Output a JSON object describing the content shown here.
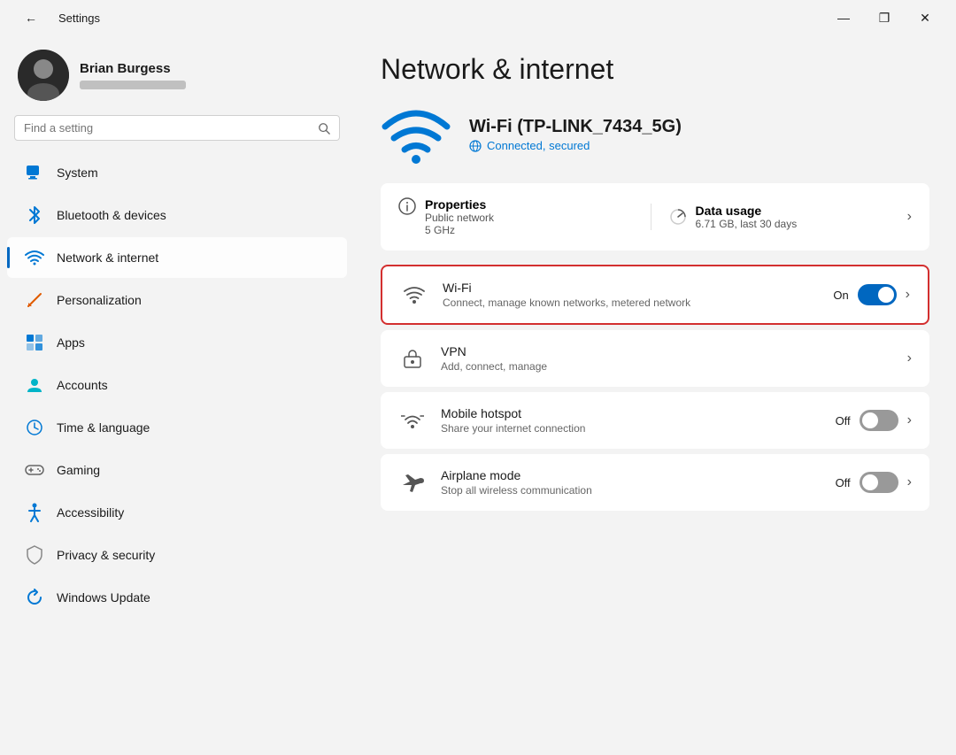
{
  "titlebar": {
    "title": "Settings",
    "back_label": "←",
    "minimize_label": "—",
    "maximize_label": "❐",
    "close_label": "✕"
  },
  "sidebar": {
    "user": {
      "name": "Brian Burgess",
      "email_placeholder": "••••••••••••"
    },
    "search_placeholder": "Find a setting",
    "items": [
      {
        "id": "system",
        "label": "System",
        "icon": "system"
      },
      {
        "id": "bluetooth",
        "label": "Bluetooth & devices",
        "icon": "bluetooth"
      },
      {
        "id": "network",
        "label": "Network & internet",
        "icon": "network",
        "active": true
      },
      {
        "id": "personalization",
        "label": "Personalization",
        "icon": "personalization"
      },
      {
        "id": "apps",
        "label": "Apps",
        "icon": "apps"
      },
      {
        "id": "accounts",
        "label": "Accounts",
        "icon": "accounts"
      },
      {
        "id": "time",
        "label": "Time & language",
        "icon": "time"
      },
      {
        "id": "gaming",
        "label": "Gaming",
        "icon": "gaming"
      },
      {
        "id": "accessibility",
        "label": "Accessibility",
        "icon": "accessibility"
      },
      {
        "id": "privacy",
        "label": "Privacy & security",
        "icon": "privacy"
      },
      {
        "id": "update",
        "label": "Windows Update",
        "icon": "update"
      }
    ]
  },
  "content": {
    "page_title": "Network & internet",
    "wifi_name": "Wi-Fi (TP-LINK_7434_5G)",
    "wifi_status": "Connected, secured",
    "properties": {
      "title": "Properties",
      "network_type": "Public network",
      "frequency": "5 GHz"
    },
    "data_usage": {
      "title": "Data usage",
      "amount": "6.71 GB, last 30 days"
    },
    "settings": [
      {
        "id": "wifi",
        "title": "Wi-Fi",
        "subtitle": "Connect, manage known networks, metered network",
        "toggle": "on",
        "toggle_label": "On",
        "highlighted": true
      },
      {
        "id": "vpn",
        "title": "VPN",
        "subtitle": "Add, connect, manage",
        "toggle": null,
        "toggle_label": null,
        "highlighted": false
      },
      {
        "id": "hotspot",
        "title": "Mobile hotspot",
        "subtitle": "Share your internet connection",
        "toggle": "off",
        "toggle_label": "Off",
        "highlighted": false
      },
      {
        "id": "airplane",
        "title": "Airplane mode",
        "subtitle": "Stop all wireless communication",
        "toggle": "off",
        "toggle_label": "Off",
        "highlighted": false
      }
    ]
  }
}
